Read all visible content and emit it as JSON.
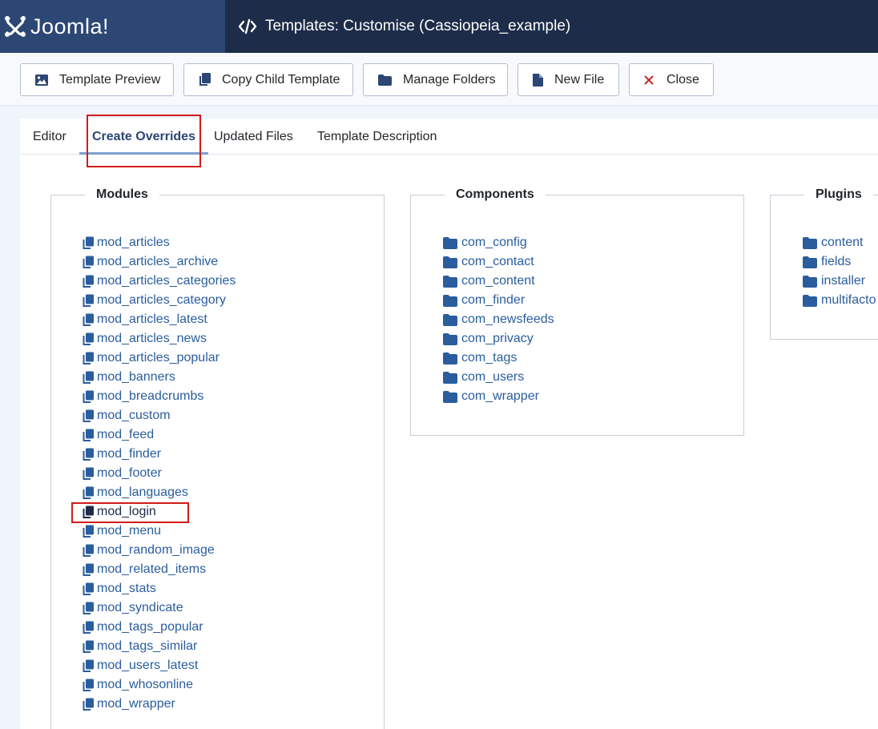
{
  "header": {
    "logo_text": "Joomla!",
    "title": "Templates: Customise (Cassiopeia_example)"
  },
  "toolbar": {
    "template_preview": "Template Preview",
    "copy_child_template": "Copy Child Template",
    "manage_folders": "Manage Folders",
    "new_file": "New File",
    "close": "Close"
  },
  "tabs": [
    "Editor",
    "Create Overrides",
    "Updated Files",
    "Template Description"
  ],
  "active_tab": "Create Overrides",
  "groups": {
    "modules": {
      "title": "Modules",
      "items": [
        "mod_articles",
        "mod_articles_archive",
        "mod_articles_categories",
        "mod_articles_category",
        "mod_articles_latest",
        "mod_articles_news",
        "mod_articles_popular",
        "mod_banners",
        "mod_breadcrumbs",
        "mod_custom",
        "mod_feed",
        "mod_finder",
        "mod_footer",
        "mod_languages",
        "mod_login",
        "mod_menu",
        "mod_random_image",
        "mod_related_items",
        "mod_stats",
        "mod_syndicate",
        "mod_tags_popular",
        "mod_tags_similar",
        "mod_users_latest",
        "mod_whosonline",
        "mod_wrapper"
      ]
    },
    "components": {
      "title": "Components",
      "items": [
        "com_config",
        "com_contact",
        "com_content",
        "com_finder",
        "com_newsfeeds",
        "com_privacy",
        "com_tags",
        "com_users",
        "com_wrapper"
      ]
    },
    "plugins": {
      "title": "Plugins",
      "items": [
        "content",
        "fields",
        "installer",
        "multifacto"
      ]
    }
  },
  "highlighted_item": "mod_login",
  "colors": {
    "header_bg": "#1d2c48",
    "logo_bg": "#2c4774",
    "link": "#2a5d9d",
    "highlight": "#d11b1b",
    "close_icon": "#c52827"
  }
}
